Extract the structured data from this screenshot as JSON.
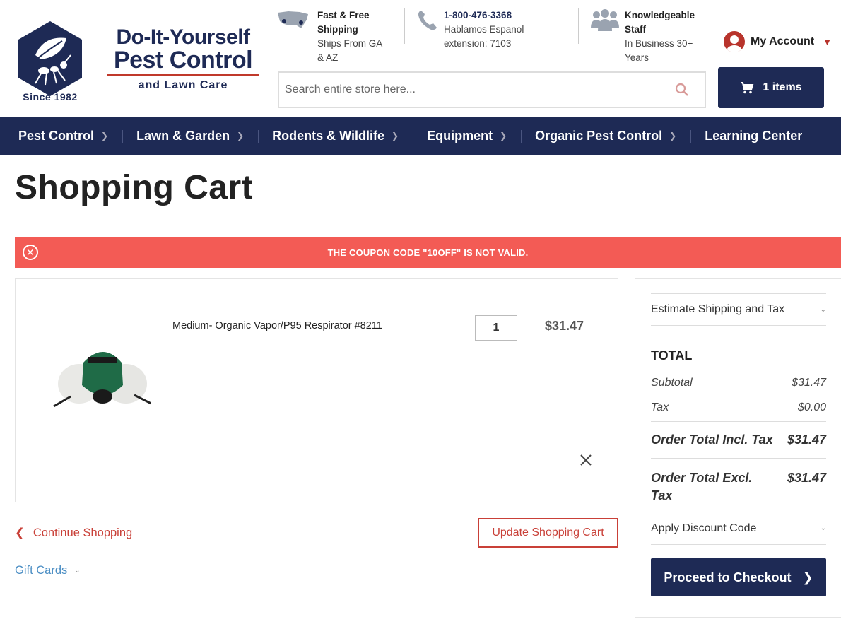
{
  "header": {
    "logo_since": "Since 1982",
    "logo_line1": "Do-It-Yourself",
    "logo_line2": "Pest Control",
    "logo_line3": "and Lawn Care",
    "shipping": {
      "title_1": "Fast & Free",
      "title_2": "Shipping",
      "sub_1": "Ships From GA",
      "sub_2": "& AZ"
    },
    "phone": {
      "number": "1-800-476-3368",
      "sub_1": "Hablamos Espanol",
      "sub_2": "extension: 7103"
    },
    "staff": {
      "title_1": "Knowledgeable",
      "title_2": "Staff",
      "sub_1": "In Business 30+",
      "sub_2": "Years"
    },
    "account_label": "My Account",
    "search_placeholder": "Search entire store here...",
    "cart_label": "1 items"
  },
  "nav": {
    "items": [
      {
        "label": "Pest Control"
      },
      {
        "label": "Lawn & Garden"
      },
      {
        "label": "Rodents & Wildlife"
      },
      {
        "label": "Equipment"
      },
      {
        "label": "Organic Pest Control"
      },
      {
        "label": "Learning Center"
      }
    ]
  },
  "page": {
    "title": "Shopping Cart",
    "alert": "THE COUPON CODE \"10OFF\" IS NOT VALID."
  },
  "cart": {
    "item": {
      "name": "Medium- Organic Vapor/P95 Respirator #8211",
      "qty": "1",
      "price": "$31.47"
    },
    "continue_label": "Continue Shopping",
    "update_label": "Update Shopping Cart",
    "gift_label": "Gift Cards"
  },
  "summary": {
    "estimate_label": "Estimate Shipping and Tax",
    "total_heading": "TOTAL",
    "subtotal_label": "Subtotal",
    "subtotal_value": "$31.47",
    "tax_label": "Tax",
    "tax_value": "$0.00",
    "incl_label": "Order Total Incl. Tax",
    "incl_value": "$31.47",
    "excl_label": "Order Total Excl. Tax",
    "excl_value": "$31.47",
    "discount_label": "Apply Discount Code",
    "checkout_label": "Proceed to Checkout"
  },
  "colors": {
    "navy": "#1e2a55",
    "alert_red": "#f35b55",
    "accent_red": "#c94038",
    "link_blue": "#4b8ec4"
  }
}
